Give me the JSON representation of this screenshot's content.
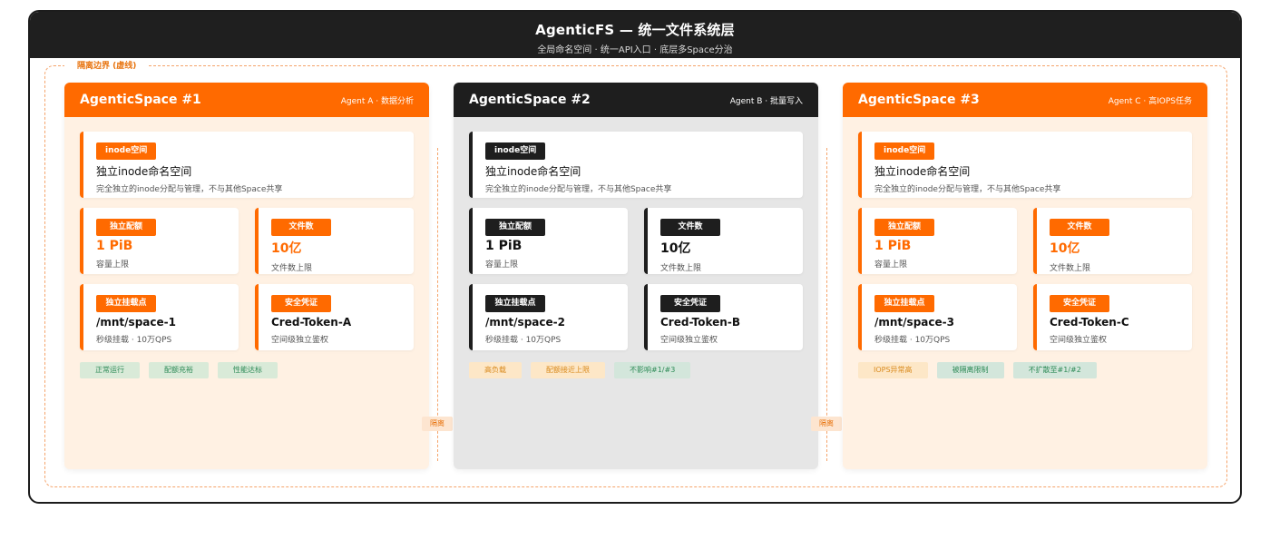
{
  "header": {
    "title": "AgenticFS — 统一文件系统层",
    "subtitle": "全局命名空间 · 统一API入口 · 底层多Space分治"
  },
  "boundary_label": "隔离边界 (虚线)",
  "separator_label": "隔离",
  "colors": {
    "accent": "#ff6a00",
    "dark": "#1e1e1e",
    "ok": "#2e8b57",
    "warn": "#d98a1c"
  },
  "spaces": [
    {
      "title": "AgenticSpace #1",
      "agent": "Agent A · 数据分析",
      "inode": {
        "tag": "inode空间",
        "main": "独立inode命名空间",
        "desc": "完全独立的inode分配与管理，不与其他Space共享"
      },
      "quota": {
        "tag": "独立配额",
        "value": "1 PiB",
        "desc": "容量上限"
      },
      "files": {
        "tag": "文件数",
        "value": "10亿",
        "desc": "文件数上限"
      },
      "mount": {
        "tag": "独立挂载点",
        "value": "/mnt/space-1",
        "desc": "秒级挂载 · 10万QPS"
      },
      "cred": {
        "tag": "安全凭证",
        "value": "Cred-Token-A",
        "desc": "空间级独立鉴权"
      },
      "badges": [
        "正常运行",
        "配额充裕",
        "性能达标"
      ]
    },
    {
      "title": "AgenticSpace #2",
      "agent": "Agent B · 批量写入",
      "inode": {
        "tag": "inode空间",
        "main": "独立inode命名空间",
        "desc": "完全独立的inode分配与管理，不与其他Space共享"
      },
      "quota": {
        "tag": "独立配额",
        "value": "1 PiB",
        "desc": "容量上限"
      },
      "files": {
        "tag": "文件数",
        "value": "10亿",
        "desc": "文件数上限"
      },
      "mount": {
        "tag": "独立挂载点",
        "value": "/mnt/space-2",
        "desc": "秒级挂载 · 10万QPS"
      },
      "cred": {
        "tag": "安全凭证",
        "value": "Cred-Token-B",
        "desc": "空间级独立鉴权"
      },
      "badges": [
        "高负载",
        "配额接近上限",
        "不影响#1/#3"
      ]
    },
    {
      "title": "AgenticSpace #3",
      "agent": "Agent C · 高IOPS任务",
      "inode": {
        "tag": "inode空间",
        "main": "独立inode命名空间",
        "desc": "完全独立的inode分配与管理，不与其他Space共享"
      },
      "quota": {
        "tag": "独立配额",
        "value": "1 PiB",
        "desc": "容量上限"
      },
      "files": {
        "tag": "文件数",
        "value": "10亿",
        "desc": "文件数上限"
      },
      "mount": {
        "tag": "独立挂载点",
        "value": "/mnt/space-3",
        "desc": "秒级挂载 · 10万QPS"
      },
      "cred": {
        "tag": "安全凭证",
        "value": "Cred-Token-C",
        "desc": "空间级独立鉴权"
      },
      "badges": [
        "IOPS异常高",
        "被隔离限制",
        "不扩散至#1/#2"
      ]
    }
  ]
}
